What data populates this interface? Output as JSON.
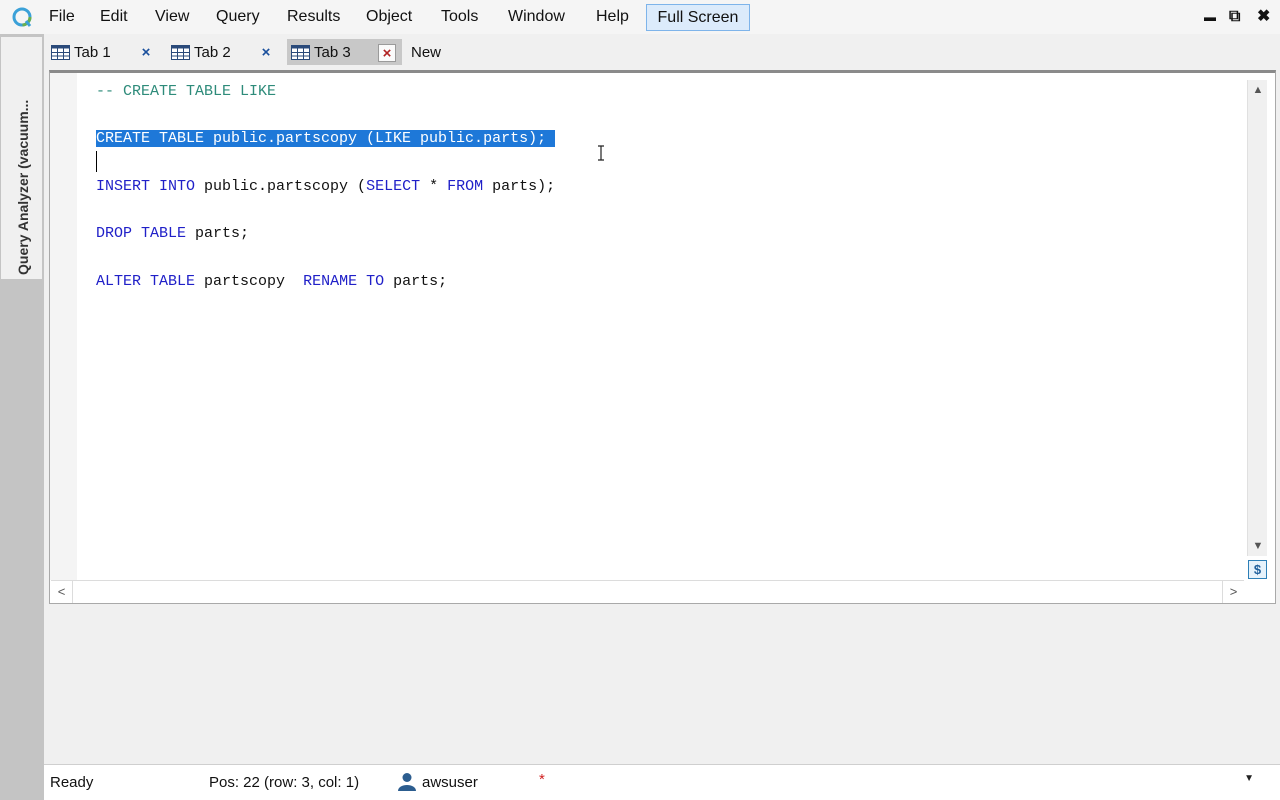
{
  "menu": {
    "items": [
      "File",
      "Edit",
      "View",
      "Query",
      "Results",
      "Object",
      "Tools",
      "Window",
      "Help"
    ],
    "full_screen": "Full Screen"
  },
  "window_controls": {
    "minimize": "▬",
    "restore": "⧉",
    "close": "✖"
  },
  "side_panel": {
    "label": "Query Analyzer (vacuum..."
  },
  "tabs": [
    {
      "label": "Tab 1",
      "close": "×",
      "active": false
    },
    {
      "label": "Tab 2",
      "close": "×",
      "active": false
    },
    {
      "label": "Tab 3",
      "close": "×",
      "active": true
    }
  ],
  "new_tab": "New",
  "editor": {
    "lines": [
      {
        "segments": [
          {
            "cls": "comment",
            "text": "-- CREATE TABLE LIKE"
          }
        ]
      },
      {
        "segments": []
      },
      {
        "segments": [
          {
            "cls": "sel",
            "text": "CREATE TABLE public.partscopy (LIKE public.parts); "
          }
        ]
      },
      {
        "segments": []
      },
      {
        "segments": [
          {
            "cls": "kw",
            "text": "INSERT INTO"
          },
          {
            "cls": "txt",
            "text": " public.partscopy ("
          },
          {
            "cls": "kw",
            "text": "SELECT"
          },
          {
            "cls": "txt",
            "text": " * "
          },
          {
            "cls": "kw",
            "text": "FROM"
          },
          {
            "cls": "txt",
            "text": " parts);"
          }
        ]
      },
      {
        "segments": []
      },
      {
        "segments": [
          {
            "cls": "kw",
            "text": "DROP TABLE"
          },
          {
            "cls": "txt",
            "text": " parts;"
          }
        ]
      },
      {
        "segments": []
      },
      {
        "segments": [
          {
            "cls": "kw",
            "text": "ALTER TABLE"
          },
          {
            "cls": "txt",
            "text": " partscopy  "
          },
          {
            "cls": "kw",
            "text": "RENAME TO"
          },
          {
            "cls": "txt",
            "text": " parts;"
          }
        ]
      }
    ]
  },
  "scroll": {
    "up": "▲",
    "down": "▼",
    "left": "<",
    "right": ">",
    "split": "$"
  },
  "status": {
    "state": "Ready",
    "position": "Pos: 22 (row: 3, col: 1)",
    "user": "awsuser",
    "modified": "*",
    "dropdown": "▼"
  },
  "colors": {
    "keyword": "#2020c8",
    "comment": "#2e8b7a",
    "selection": "#1e78d8",
    "fullscreen_button": "#dcebfb"
  }
}
